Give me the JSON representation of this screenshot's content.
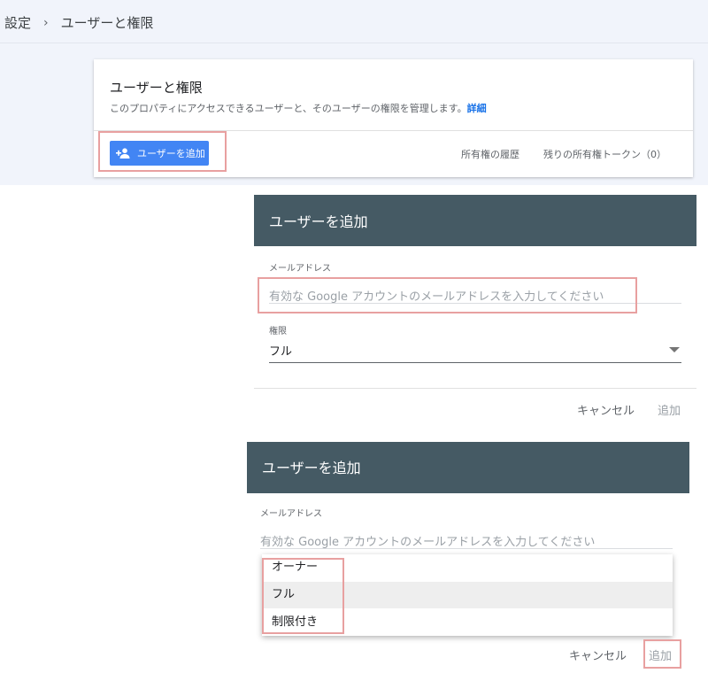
{
  "breadcrumb": {
    "root": "設定",
    "separator": "›",
    "current": "ユーザーと権限"
  },
  "card": {
    "title": "ユーザーと権限",
    "description": "このプロパティにアクセスできるユーザーと、そのユーザーの権限を管理します。",
    "detail_link": "詳細",
    "add_user_button": "ユーザーを追加",
    "ownership_history": "所有権の履歴",
    "remaining_tokens": "残りの所有権トークン（0）"
  },
  "dialog1": {
    "title": "ユーザーを追加",
    "email_label": "メールアドレス",
    "email_placeholder": "有効な Google アカウントのメールアドレスを入力してください",
    "permission_label": "権限",
    "permission_value": "フル",
    "cancel": "キャンセル",
    "add": "追加"
  },
  "dialog2": {
    "title": "ユーザーを追加",
    "email_label": "メールアドレス",
    "email_placeholder": "有効な Google アカウントのメールアドレスを入力してください",
    "options": [
      "オーナー",
      "フル",
      "制限付き"
    ],
    "selected_option": "フル",
    "cancel": "キャンセル",
    "add": "追加"
  },
  "colors": {
    "accent": "#4285f4",
    "dialog_header": "#455a64",
    "highlight": "#e8a0a0",
    "link": "#1a73e8"
  }
}
